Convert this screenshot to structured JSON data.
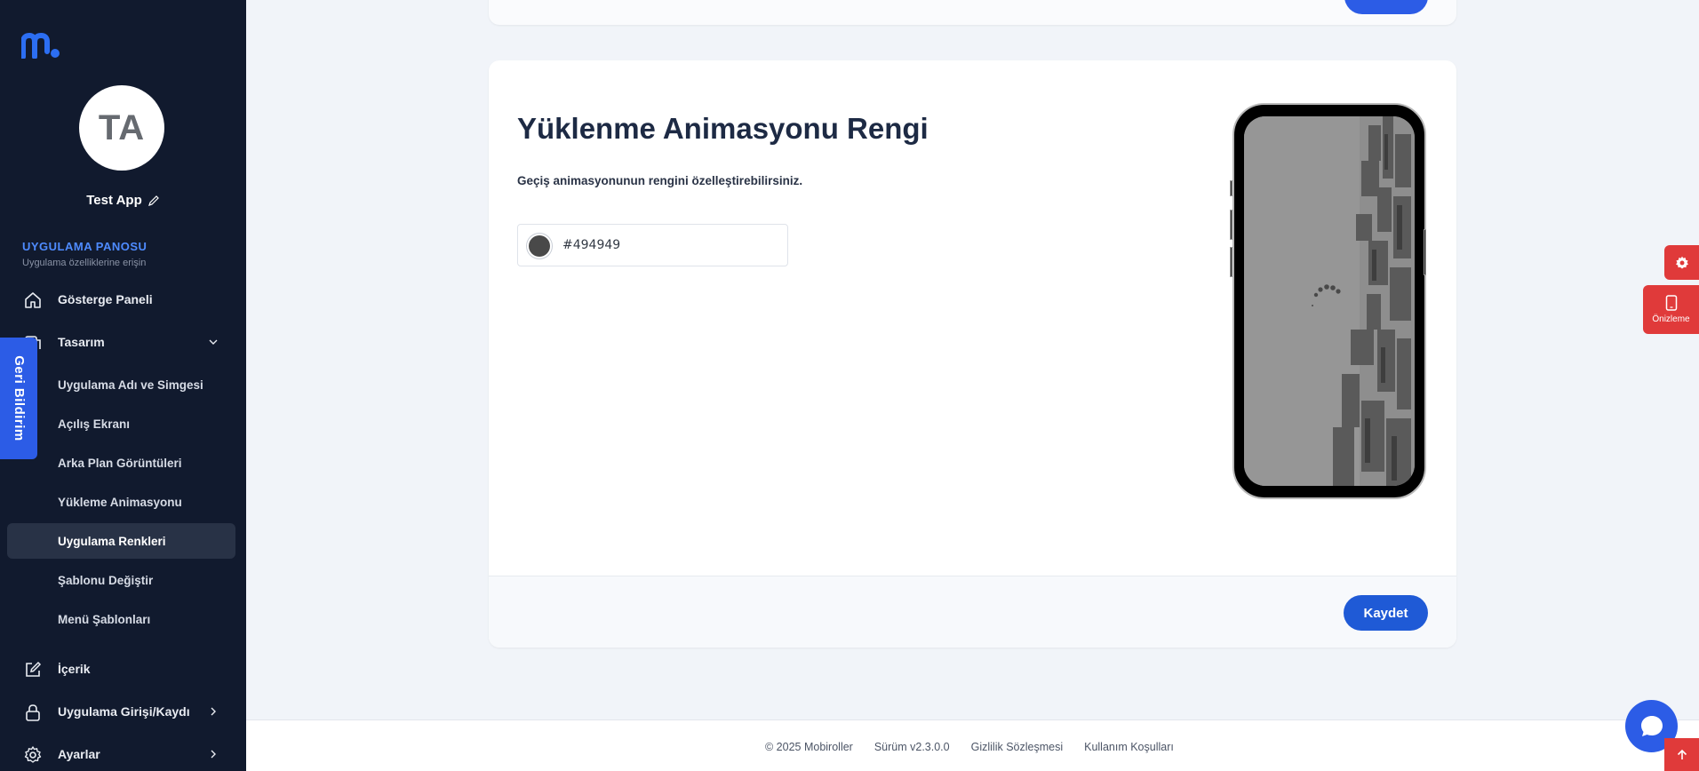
{
  "sidebar": {
    "avatar_initials": "TA",
    "app_name": "Test App",
    "section_title": "UYGULAMA PANOSU",
    "section_subtitle": "Uygulama özelliklerine erişin",
    "items": [
      {
        "label": "Gösterge Paneli",
        "icon": "home-icon"
      },
      {
        "label": "Tasarım",
        "icon": "design-icon"
      },
      {
        "label": "İçerik",
        "icon": "edit-icon"
      },
      {
        "label": "Uygulama Girişi/Kaydı",
        "icon": "lock-icon"
      },
      {
        "label": "Ayarlar",
        "icon": "gear-icon"
      }
    ],
    "design_subitems": [
      "Uygulama Adı ve Simgesi",
      "Açılış Ekranı",
      "Arka Plan Görüntüleri",
      "Yükleme Animasyonu",
      "Uygulama Renkleri",
      "Şablonu Değiştir",
      "Menü Şablonları"
    ],
    "active_subitem": "Uygulama Renkleri"
  },
  "feedback_tab": "Geri Bildirim",
  "main": {
    "title": "Yüklenme Animasyonu Rengi",
    "description": "Geçiş animasyonunun rengini özelleştirebilirsiniz.",
    "color_value": "#494949",
    "save_label": "Kaydet"
  },
  "floating": {
    "preview_label": "Önizleme"
  },
  "footer": {
    "copyright": "© 2025 Mobiroller",
    "version": "Sürüm v2.3.0.0",
    "privacy": "Gizlilik Sözleşmesi",
    "terms": "Kullanım Koşulları"
  },
  "colors": {
    "sidebar_bg": "#111a2e",
    "accent": "#2c5ce6",
    "danger": "#e03a3a",
    "loader_color": "#494949"
  }
}
